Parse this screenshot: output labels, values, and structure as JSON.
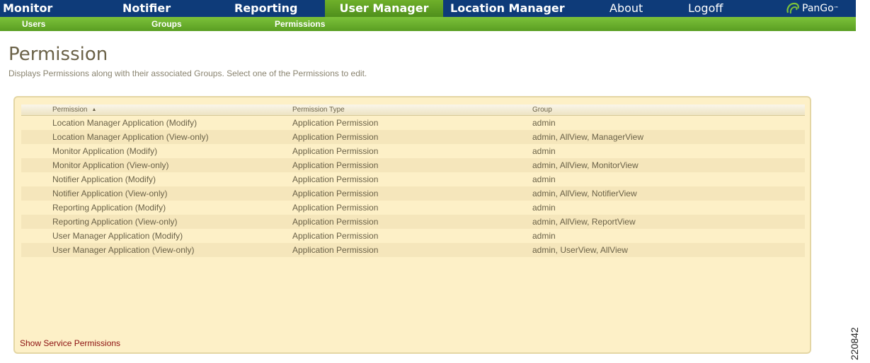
{
  "topnav": {
    "tabs": [
      {
        "label": "Monitor"
      },
      {
        "label": "Notifier"
      },
      {
        "label": "Reporting"
      },
      {
        "label": "User Manager"
      },
      {
        "label": "Location Manager"
      },
      {
        "label": "About"
      },
      {
        "label": "Logoff"
      }
    ],
    "active_tab": "User Manager",
    "logo_text": "PanGo",
    "logo_mark": "™"
  },
  "subnav": {
    "items": [
      {
        "label": "Users"
      },
      {
        "label": "Groups"
      },
      {
        "label": "Permissions"
      }
    ]
  },
  "page": {
    "title": "Permission",
    "description": "Displays Permissions along with their associated Groups. Select one of the Permissions to edit."
  },
  "grid": {
    "columns": [
      {
        "label": "Permission",
        "sort": "ascending"
      },
      {
        "label": "Permission Type"
      },
      {
        "label": "Group"
      }
    ],
    "sort_icon": "▲",
    "rows": [
      {
        "permission": "Location Manager Application (Modify)",
        "type": "Application Permission",
        "group": "admin"
      },
      {
        "permission": "Location Manager Application (View-only)",
        "type": "Application Permission",
        "group": "admin, AllView, ManagerView"
      },
      {
        "permission": "Monitor Application (Modify)",
        "type": "Application Permission",
        "group": "admin"
      },
      {
        "permission": "Monitor Application (View-only)",
        "type": "Application Permission",
        "group": "admin, AllView, MonitorView"
      },
      {
        "permission": "Notifier Application (Modify)",
        "type": "Application Permission",
        "group": "admin"
      },
      {
        "permission": "Notifier Application (View-only)",
        "type": "Application Permission",
        "group": "admin, AllView, NotifierView"
      },
      {
        "permission": "Reporting Application (Modify)",
        "type": "Application Permission",
        "group": "admin"
      },
      {
        "permission": "Reporting Application (View-only)",
        "type": "Application Permission",
        "group": "admin, AllView, ReportView"
      },
      {
        "permission": "User Manager Application (Modify)",
        "type": "Application Permission",
        "group": "admin"
      },
      {
        "permission": "User Manager Application (View-only)",
        "type": "Application Permission",
        "group": "admin, UserView, AllView"
      }
    ]
  },
  "footer": {
    "service_link": "Show Service Permissions"
  },
  "figure_id": "220842",
  "colors": {
    "nav_bg": "#0e3b79",
    "active_tab": "#5fa224",
    "subnav": "#6bb02e",
    "panel_bg": "#fdf0c7",
    "link": "#8b0f0f"
  }
}
